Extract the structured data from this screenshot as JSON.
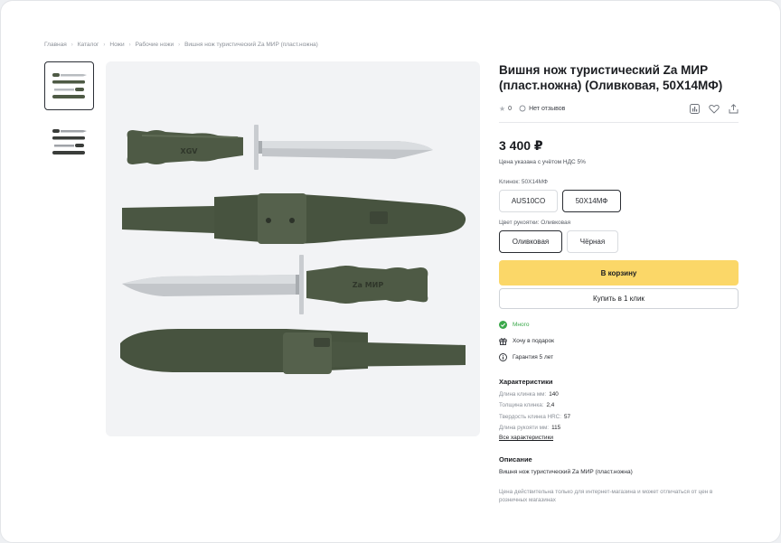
{
  "breadcrumb": [
    "Главная",
    "Каталог",
    "Ножи",
    "Рабочие ножи",
    "Вишня нож туристический Za МИР (пласт.ножна)"
  ],
  "product": {
    "title": "Вишня нож туристический Za МИР (пласт.ножна) (Оливковая, 50Х14МФ)",
    "rating": "0",
    "reviews": "Нет отзывов",
    "price": "3 400 ₽",
    "vat_note": "Цена указана с учётом НДС 5%",
    "blade_label": "Клинок: 50Х14МФ",
    "blade_options": [
      "AUS10CO",
      "50Х14МФ"
    ],
    "blade_selected": 1,
    "color_label": "Цвет рукоятки: Оливковая",
    "color_options": [
      "Оливковая",
      "Чёрная"
    ],
    "color_selected": 0,
    "cart_button": "В корзину",
    "oneclick_button": "Купить в 1 клик",
    "stock": "Много",
    "gift": "Хочу в подарок",
    "warranty": "Гарантия 5 лет",
    "handle_engraving": "XGV",
    "handle_engraving_2": "Za МИР"
  },
  "specs": {
    "title": "Характеристики",
    "items": [
      {
        "label": "Длина клинка мм:",
        "value": "140"
      },
      {
        "label": "Толщина клинка:",
        "value": "2,4"
      },
      {
        "label": "Твердость клинка HRC:",
        "value": "57"
      },
      {
        "label": "Длина рукояти мм:",
        "value": "115"
      }
    ],
    "all_link": "Все характеристики"
  },
  "description": {
    "title": "Описание",
    "text": "Вишня нож туристический Za МИР (пласт.ножна)",
    "note": "Цена действительна только для интернет-магазина и может отличаться от цен в розничных магазинах"
  },
  "colors": {
    "accent": "#fbd768",
    "olive": "#4e5a45",
    "stock": "#3aa84a"
  }
}
